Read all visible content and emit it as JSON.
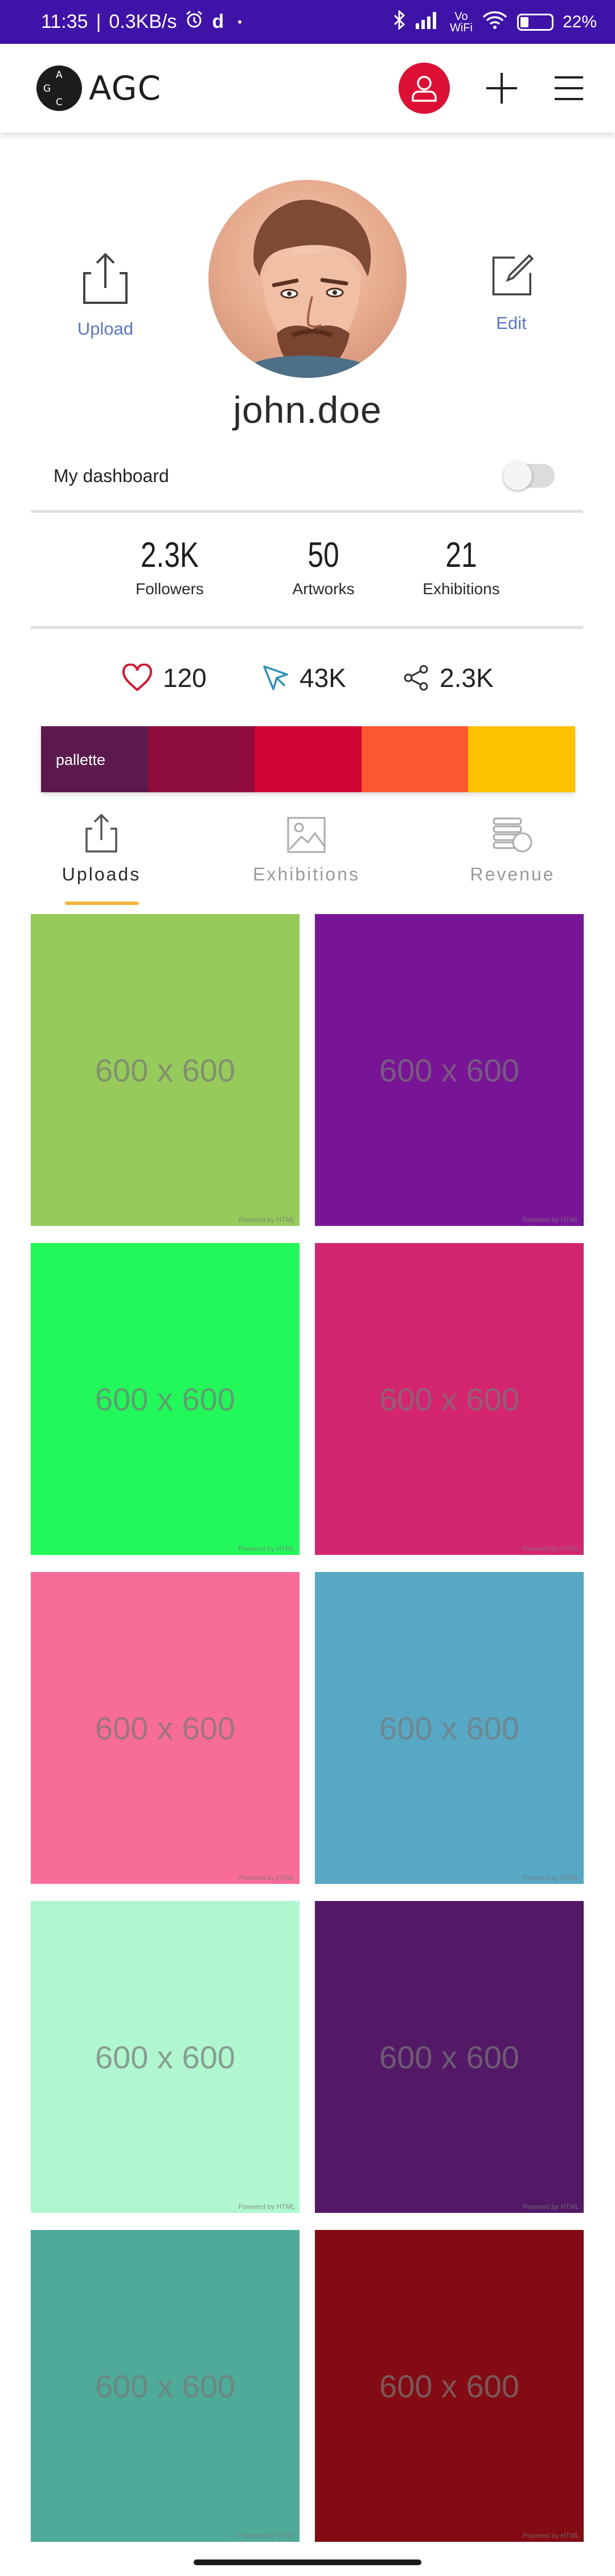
{
  "status_bar": {
    "time": "11:35",
    "speed": "0.3KB/s",
    "app_glyph": "d",
    "dot": "•",
    "network": "Vo WiFi",
    "battery": "22%",
    "icons": [
      "alarm-icon",
      "bluetooth-icon",
      "signal-icon",
      "wifi-icon",
      "battery-icon"
    ]
  },
  "header": {
    "logo_letters": [
      "A",
      "G",
      "C"
    ],
    "logo_text": "AGC",
    "accent_color": "#dc1035",
    "icons": [
      "user-icon",
      "plus-icon",
      "menu-icon"
    ]
  },
  "profile": {
    "upload_label": "Upload",
    "edit_label": "Edit",
    "username": "john.doe",
    "dashboard_label": "My dashboard",
    "dashboard_enabled": false
  },
  "stats": [
    {
      "value": "2.3K",
      "label": "Followers"
    },
    {
      "value": "50",
      "label": "Artworks"
    },
    {
      "value": "21",
      "label": "Exhibitions"
    }
  ],
  "metrics": {
    "likes": "120",
    "clicks": "43K",
    "shares": "2.3K",
    "icons": [
      "heart-icon",
      "cursor-icon",
      "share-icon"
    ]
  },
  "palette": {
    "label": "pallette",
    "colors": [
      "#5b1a4b",
      "#8f0d3d",
      "#cf0535",
      "#fd5732",
      "#fec200"
    ]
  },
  "tabs": [
    {
      "label": "Uploads",
      "icon": "upload-icon",
      "active": true
    },
    {
      "label": "Exhibitions",
      "icon": "image-icon",
      "active": false
    },
    {
      "label": "Revenue",
      "icon": "coins-icon",
      "active": false
    }
  ],
  "grid": {
    "placeholder_text": "600 x 600",
    "powered_text": "Powered by HTML",
    "tile_colors": [
      "#96cb5b",
      "#781496",
      "#23f85b",
      "#d42670",
      "#f76d97",
      "#57a8c5",
      "#b0f7d0",
      "#531866",
      "#50aa99",
      "#830b14"
    ]
  }
}
